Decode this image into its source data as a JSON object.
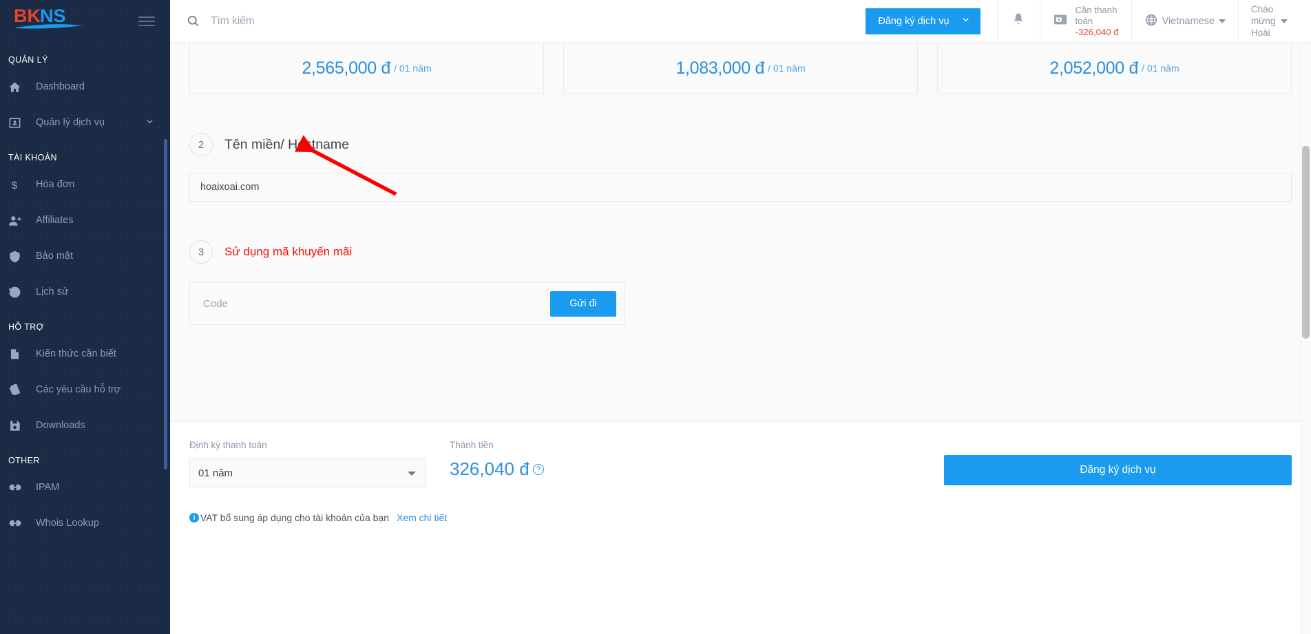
{
  "brand": {
    "name_part1": "BK",
    "name_part2": "NS"
  },
  "sidebar": {
    "sections": [
      {
        "title": "QUẢN LÝ",
        "items": [
          {
            "label": "Dashboard",
            "icon": "home-icon",
            "chevron": ""
          },
          {
            "label": "Quản lý dịch vụ",
            "icon": "id-card-icon",
            "chevron": "⌄"
          }
        ]
      },
      {
        "title": "TÀI KHOẢN",
        "items": [
          {
            "label": "Hóa đơn",
            "icon": "dollar-icon",
            "chevron": ""
          },
          {
            "label": "Affiliates",
            "icon": "user-plus-icon",
            "chevron": ""
          },
          {
            "label": "Bảo mật",
            "icon": "shield-icon",
            "chevron": ""
          },
          {
            "label": "Lịch sử",
            "icon": "history-icon",
            "chevron": ""
          }
        ]
      },
      {
        "title": "HỖ TRỢ",
        "items": [
          {
            "label": "Kiến thức cần biết",
            "icon": "document-icon",
            "chevron": ""
          },
          {
            "label": "Các yêu cầu hỗ trợ",
            "icon": "ticket-icon",
            "chevron": ""
          },
          {
            "label": "Downloads",
            "icon": "save-icon",
            "chevron": ""
          }
        ]
      },
      {
        "title": "OTHER",
        "items": [
          {
            "label": "IPAM",
            "icon": "link-icon",
            "chevron": ""
          },
          {
            "label": "Whois Lookup",
            "icon": "link-icon",
            "chevron": ""
          }
        ]
      }
    ]
  },
  "topbar": {
    "search_placeholder": "Tìm kiếm",
    "search_value": "",
    "search_icon": "search-icon",
    "register_button": "Đăng ký dịch vụ",
    "register_chevron": "⌄",
    "bell_icon": "bell-icon",
    "wallet_icon": "wallet-icon",
    "payment_label_line1": "Cần thanh",
    "payment_label_line2": "toán",
    "payment_amount": "-326,040 đ",
    "globe_icon": "globe-icon",
    "language": "Vietnamese",
    "greeting_line1": "Chào",
    "greeting_line2": "mừng",
    "greeting_line3": "Hoài"
  },
  "main": {
    "price_cards": [
      {
        "amount": "2,565,000 đ",
        "period": "/ 01 năm"
      },
      {
        "amount": "1,083,000 đ",
        "period": "/ 01 năm"
      },
      {
        "amount": "2,052,000 đ",
        "period": "/ 01 năm"
      }
    ],
    "step2": {
      "number": "2",
      "title": "Tên miền/ Hostname",
      "input_value": "hoaixoai.com",
      "input_placeholder": ""
    },
    "step3": {
      "number": "3",
      "title": "Sử dụng mã khuyến mãi",
      "title_color": "#fa1000",
      "code_placeholder": "Code",
      "code_value": "",
      "send_button": "Gửi đi"
    }
  },
  "bottombar": {
    "term_label": "Định kỳ thanh toán",
    "term_selected": "01 năm",
    "term_options": [
      "01 năm"
    ],
    "total_label": "Thành tiền",
    "total_amount": "326,040 đ",
    "help_icon": "question-icon",
    "submit_button": "Đăng ký dịch vụ",
    "info_icon": "info-icon",
    "vat_note": "VAT bổ sung áp dụng cho tài khoản của bạn",
    "vat_link": "Xem chi tiết"
  },
  "colors": {
    "accent_blue": "#1a9bef",
    "price_blue": "#2b8fe0",
    "sidebar_bg": "#1c2b45",
    "danger_red": "#e8443a",
    "annotation_red": "#fa1000"
  }
}
